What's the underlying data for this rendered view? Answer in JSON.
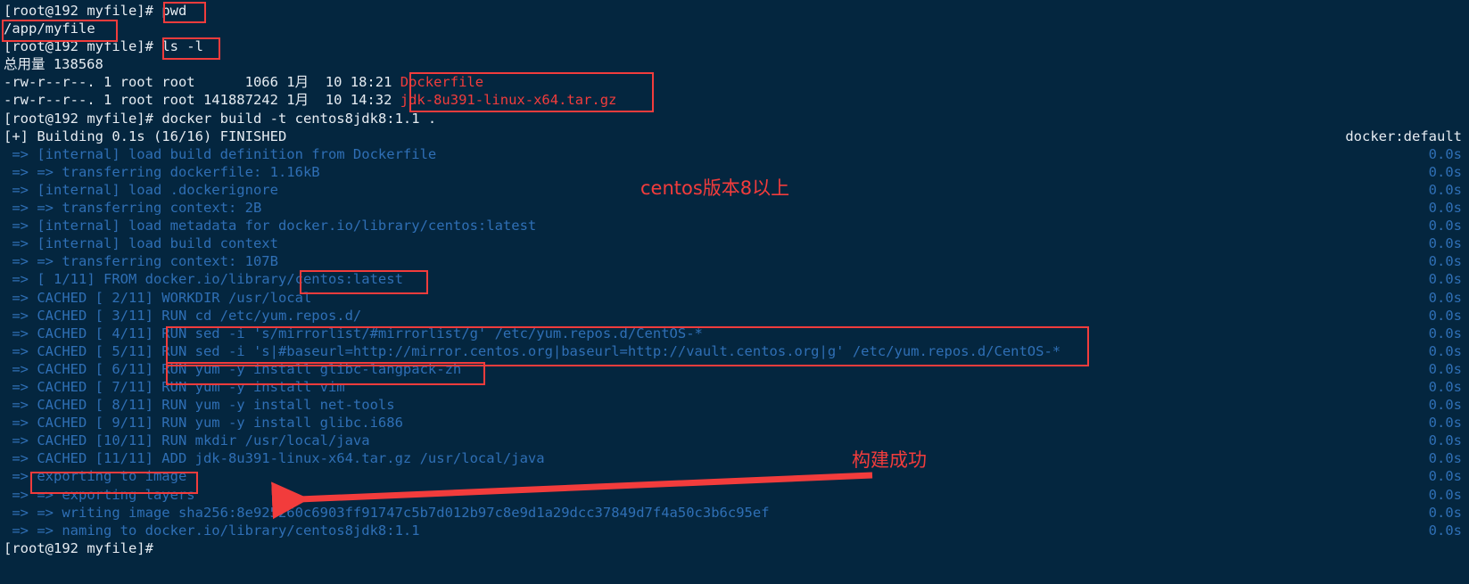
{
  "terminal": {
    "prompt": "[root@192 myfile]#",
    "right_builder_label": "docker:default",
    "lines": [
      {
        "id": "l1",
        "prompt": "[root@192 myfile]# ",
        "cmd": "pwd"
      },
      {
        "id": "l2",
        "text": "/app/myfile"
      },
      {
        "id": "l3",
        "prompt": "[root@192 myfile]# ",
        "cmd": "ls -l"
      },
      {
        "id": "l4",
        "text": "总用量 138568"
      },
      {
        "id": "l5",
        "text": "-rw-r--r--. 1 root root      1066 1月  10 18:21 ",
        "file": "Dockerfile"
      },
      {
        "id": "l6",
        "text": "-rw-r--r--. 1 root root 141887242 1月  10 14:32 ",
        "file": "jdk-8u391-linux-x64.tar.gz"
      },
      {
        "id": "l7",
        "prompt": "[root@192 myfile]# ",
        "cmd": "docker build -t centos8jdk8:1.1 ."
      },
      {
        "id": "l8",
        "text": "[+] Building 0.1s (16/16) FINISHED",
        "right": "docker:default"
      },
      {
        "id": "l9",
        "text": " => [internal] load build definition from Dockerfile",
        "time": "0.0s"
      },
      {
        "id": "l10",
        "text": " => => transferring dockerfile: 1.16kB",
        "time": "0.0s"
      },
      {
        "id": "l11",
        "text": " => [internal] load .dockerignore",
        "time": "0.0s"
      },
      {
        "id": "l12",
        "text": " => => transferring context: 2B",
        "time": "0.0s"
      },
      {
        "id": "l13",
        "text": " => [internal] load metadata for docker.io/library/centos:latest",
        "time": "0.0s"
      },
      {
        "id": "l14",
        "text": " => [internal] load build context",
        "time": "0.0s"
      },
      {
        "id": "l15",
        "text": " => => transferring context: 107B",
        "time": "0.0s"
      },
      {
        "id": "l16",
        "text": " => [ 1/11] FROM docker.io/library/centos:latest",
        "time": "0.0s"
      },
      {
        "id": "l17",
        "text": " => CACHED [ 2/11] WORKDIR /usr/local",
        "time": "0.0s"
      },
      {
        "id": "l18",
        "text": " => CACHED [ 3/11] RUN cd /etc/yum.repos.d/",
        "time": "0.0s"
      },
      {
        "id": "l19",
        "text": " => CACHED [ 4/11] RUN sed -i 's/mirrorlist/#mirrorlist/g' /etc/yum.repos.d/CentOS-*",
        "time": "0.0s"
      },
      {
        "id": "l20",
        "text": " => CACHED [ 5/11] RUN sed -i 's|#baseurl=http://mirror.centos.org|baseurl=http://vault.centos.org|g' /etc/yum.repos.d/CentOS-*",
        "time": "0.0s"
      },
      {
        "id": "l21",
        "text": " => CACHED [ 6/11] RUN yum -y install glibc-langpack-zh",
        "time": "0.0s"
      },
      {
        "id": "l22",
        "text": " => CACHED [ 7/11] RUN yum -y install vim",
        "time": "0.0s"
      },
      {
        "id": "l23",
        "text": " => CACHED [ 8/11] RUN yum -y install net-tools",
        "time": "0.0s"
      },
      {
        "id": "l24",
        "text": " => CACHED [ 9/11] RUN yum -y install glibc.i686",
        "time": "0.0s"
      },
      {
        "id": "l25",
        "text": " => CACHED [10/11] RUN mkdir /usr/local/java",
        "time": "0.0s"
      },
      {
        "id": "l26",
        "text": " => CACHED [11/11] ADD jdk-8u391-linux-x64.tar.gz /usr/local/java",
        "time": "0.0s"
      },
      {
        "id": "l27",
        "text": " => exporting to image",
        "time": "0.0s"
      },
      {
        "id": "l28",
        "text": " => => exporting layers",
        "time": "0.0s"
      },
      {
        "id": "l29",
        "text": " => => writing image sha256:8e925260c6903ff91747c5b7d012b97c8e9d1a29dcc37849d7f4a50c3b6c95ef",
        "time": "0.0s"
      },
      {
        "id": "l30",
        "text": " => => naming to docker.io/library/centos8jdk8:1.1",
        "time": "0.0s"
      },
      {
        "id": "l31",
        "prompt": "[root@192 myfile]#",
        "cmd": ""
      }
    ]
  },
  "annotations": {
    "note_centos_version": "centos版本8以上",
    "note_build_success": "构建成功",
    "highlight_pwd": "pwd",
    "highlight_path": "/app/myfile",
    "highlight_ls": "ls -l",
    "highlight_dockerfile": "Dockerfile",
    "highlight_tarball": "jdk-8u391-linux-x64.tar.gz",
    "highlight_base_image": "centos:latest",
    "highlight_sed_block": "RUN sed -i",
    "highlight_langpack": "RUN yum -y install glibc-langpack-zh",
    "highlight_exporting": "exporting to image"
  },
  "colors": {
    "background": "#04263f",
    "text": "#e6ecf2",
    "build_blue": "#2f6fb5",
    "annotation_red": "#f23c3c"
  }
}
